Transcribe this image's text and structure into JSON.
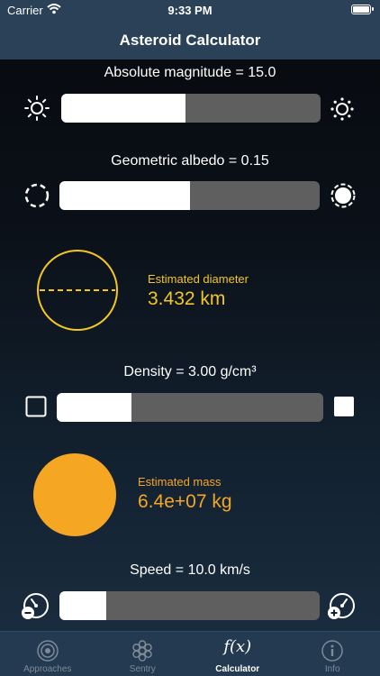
{
  "status_bar": {
    "carrier": "Carrier",
    "time": "9:33 PM"
  },
  "nav": {
    "title": "Asteroid Calculator"
  },
  "magnitude": {
    "label": "Absolute magnitude =  15.0",
    "level": 0.48
  },
  "albedo": {
    "label": "Geometric albedo =  0.15",
    "level": 0.5
  },
  "diameter": {
    "label": "Estimated diameter",
    "value": "3.432 km"
  },
  "density": {
    "label": "Density =  3.00 g/cm³",
    "level": 0.28
  },
  "mass": {
    "label": "Estimated mass",
    "value": "6.4e+07 kg"
  },
  "speed": {
    "label": "Speed =  10.0 km/s",
    "level": 0.18
  },
  "tabs": [
    {
      "label": "Approaches",
      "icon": "approaches-icon"
    },
    {
      "label": "Sentry",
      "icon": "sentry-icon"
    },
    {
      "label": "Calculator",
      "icon": "fx-icon",
      "glyph": "f(x)"
    },
    {
      "label": "Info",
      "icon": "info-icon"
    }
  ],
  "colors": {
    "bar": "#2a4158",
    "accent_yellow": "#f3c623",
    "accent_orange": "#f5a623",
    "slider_track": "#5f5f5f"
  }
}
